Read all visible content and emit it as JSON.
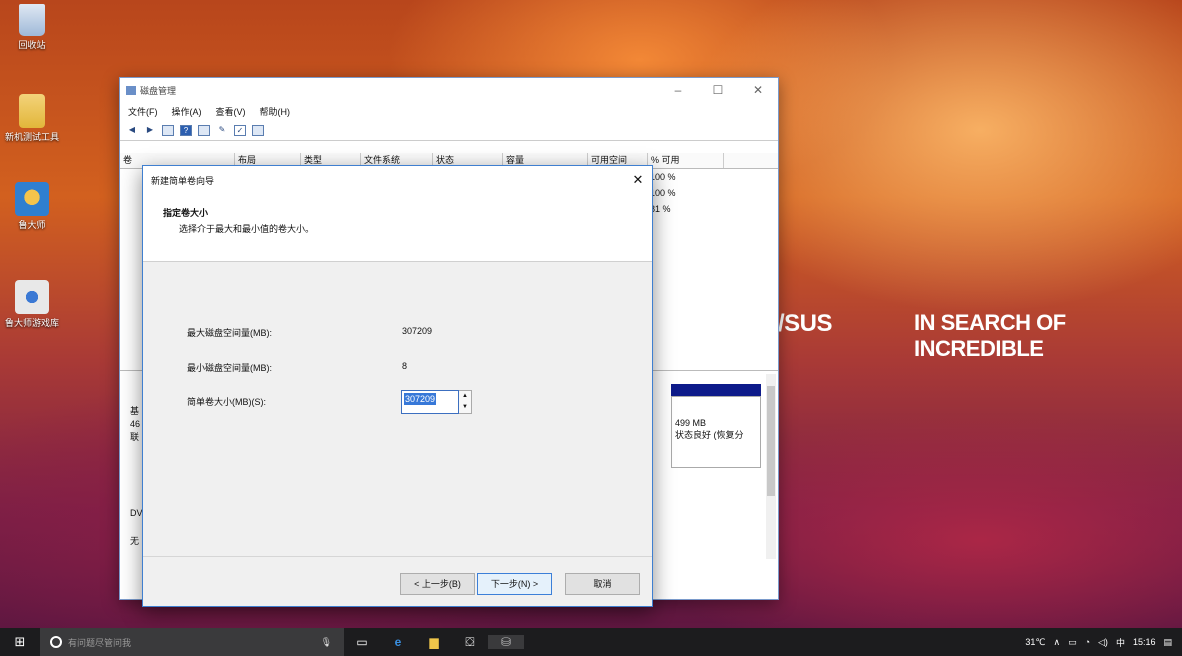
{
  "desktop": {
    "icons": [
      {
        "label": "回收站",
        "color": "#9fb9d8"
      },
      {
        "label": "新机测试工具",
        "color": "#e2b63a"
      },
      {
        "label": "鲁大师",
        "color": "#2f7fd0"
      },
      {
        "label": "鲁大师游戏库",
        "color": "#e8e8e8"
      }
    ]
  },
  "wallpaper": {
    "brand_logo": "/SUS",
    "tagline": "IN SEARCH OF INCREDIBLE"
  },
  "disk_mgmt": {
    "title": "磁盘管理",
    "menu": [
      "文件(F)",
      "操作(A)",
      "查看(V)",
      "帮助(H)"
    ],
    "columns": [
      "卷",
      "布局",
      "类型",
      "文件系统",
      "状态",
      "容量",
      "可用空间",
      "% 可用"
    ],
    "pct_rows": [
      "100 %",
      "100 %",
      "81 %"
    ],
    "lower_left": [
      "基",
      "46",
      "联"
    ],
    "lower_left2": [
      "DV",
      "无"
    ],
    "partition_size": "499 MB",
    "partition_status": "状态良好 (恢复分"
  },
  "wizard": {
    "title": "新建简单卷向导",
    "header_title": "指定卷大小",
    "header_desc": "选择介于最大和最小值的卷大小。",
    "max_label": "最大磁盘空间量(MB):",
    "max_value": "307209",
    "min_label": "最小磁盘空间量(MB):",
    "min_value": "8",
    "size_label": "简单卷大小(MB)(S):",
    "size_value": "307209",
    "back": "< 上一步(B)",
    "next": "下一步(N) >",
    "cancel": "取消"
  },
  "taskbar": {
    "search_placeholder": "有问题尽管问我",
    "temp": "31℃",
    "ime": "中",
    "time": "15:16"
  }
}
